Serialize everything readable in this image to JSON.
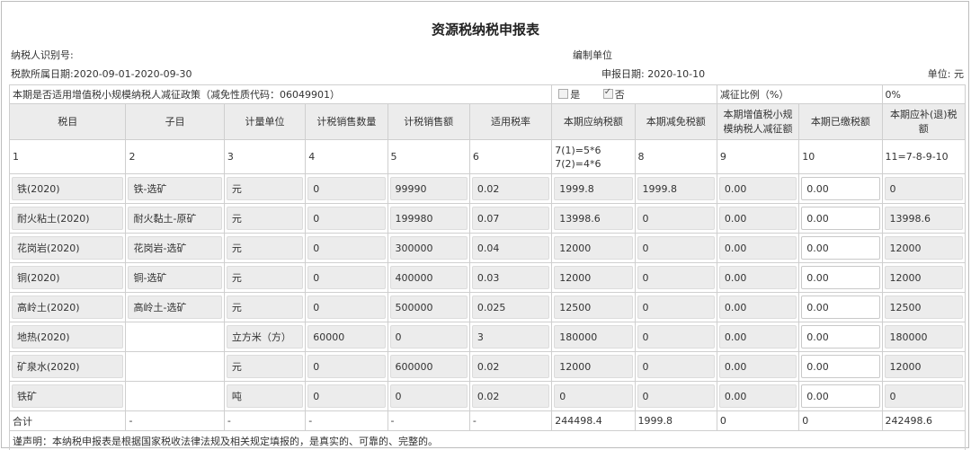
{
  "title": "资源税纳税申报表",
  "header": {
    "taxpayer_id_label": "纳税人识别号:",
    "org_label": "编制单位",
    "period_label": "税款所属日期:2020-09-01-2020-09-30",
    "declare_date_label": "申报日期:  2020-10-10",
    "unit_label": "单位:  元"
  },
  "policy": {
    "question": "本期是否适用增值税小规模纳税人减征政策（减免性质代码：06049901）",
    "yes_label": "是",
    "no_label": "否",
    "yes_checked": false,
    "no_checked": true,
    "ratio_label": "减征比例（%）",
    "ratio_value": "0%"
  },
  "columns": [
    "税目",
    "子目",
    "计量单位",
    "计税销售数量",
    "计税销售额",
    "适用税率",
    "本期应纳税额",
    "本期减免税额",
    "本期增值税小规模纳税人减征额",
    "本期已缴税额",
    "本期应补(退)税额"
  ],
  "column_numbers": [
    "1",
    "2",
    "3",
    "4",
    "5",
    "6",
    "7(1)=5*6\n7(2)=4*6",
    "8",
    "9",
    "10",
    "11=7-8-9-10"
  ],
  "rows": [
    [
      "铁(2020)",
      "铁-选矿",
      "元",
      "0",
      "99990",
      "0.02",
      "1999.8",
      "1999.8",
      "0.00",
      "0.00",
      "0"
    ],
    [
      "耐火粘土(2020)",
      "耐火黏土-原矿",
      "元",
      "0",
      "199980",
      "0.07",
      "13998.6",
      "0",
      "0.00",
      "0.00",
      "13998.6"
    ],
    [
      "花岗岩(2020)",
      "花岗岩-选矿",
      "元",
      "0",
      "300000",
      "0.04",
      "12000",
      "0",
      "0.00",
      "0.00",
      "12000"
    ],
    [
      "铜(2020)",
      "铜-选矿",
      "元",
      "0",
      "400000",
      "0.03",
      "12000",
      "0",
      "0.00",
      "0.00",
      "12000"
    ],
    [
      "高岭土(2020)",
      "高岭土-选矿",
      "元",
      "0",
      "500000",
      "0.025",
      "12500",
      "0",
      "0.00",
      "0.00",
      "12500"
    ],
    [
      "地热(2020)",
      "",
      "立方米（方）",
      "60000",
      "0",
      "3",
      "180000",
      "0",
      "0.00",
      "0.00",
      "180000"
    ],
    [
      "矿泉水(2020)",
      "",
      "元",
      "0",
      "600000",
      "0.02",
      "12000",
      "0",
      "0.00",
      "0.00",
      "12000"
    ],
    [
      "铁矿",
      "",
      "吨",
      "0",
      "0",
      "0.02",
      "0",
      "0",
      "0.00",
      "0.00",
      "0"
    ]
  ],
  "total": [
    "合计",
    "-",
    "-",
    "-",
    "-",
    "-",
    "244498.4",
    "1999.8",
    "0",
    "0",
    "242498.6"
  ],
  "declaration": "谨声明：本纳税申报表是根据国家税收法律法规及相关规定填报的，是真实的、可靠的、完整的。"
}
